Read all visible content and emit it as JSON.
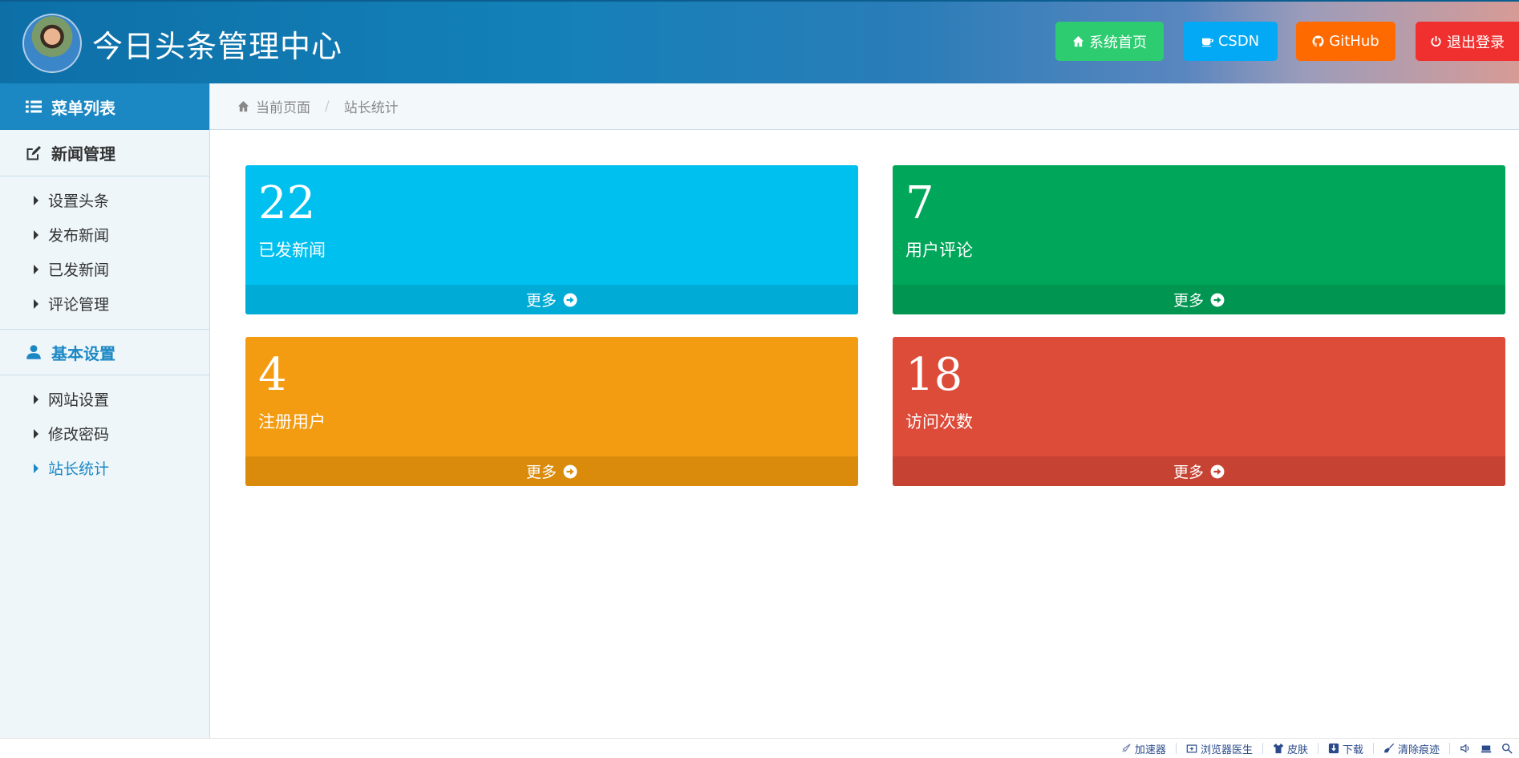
{
  "header": {
    "title": "今日头条管理中心",
    "buttons": [
      {
        "label": "系统首页",
        "icon": "home-icon",
        "color": "#2ecc71"
      },
      {
        "label": "CSDN",
        "icon": "coffee-icon",
        "color": "#03a9f4"
      },
      {
        "label": "GitHub",
        "icon": "github-icon",
        "color": "#ff6a00"
      },
      {
        "label": "退出登录",
        "icon": "power-icon",
        "color": "#f0302f"
      }
    ]
  },
  "sidebar": {
    "menu_title": "菜单列表",
    "groups": [
      {
        "title": "新闻管理",
        "icon": "edit-icon",
        "items": [
          "设置头条",
          "发布新闻",
          "已发新闻",
          "评论管理"
        ]
      },
      {
        "title": "基本设置",
        "icon": "user-icon",
        "items": [
          "网站设置",
          "修改密码",
          "站长统计"
        ]
      }
    ],
    "active_item": "站长统计"
  },
  "breadcrumb": {
    "home": "当前页面",
    "current": "站长统计"
  },
  "cards": [
    {
      "value": "22",
      "label": "已发新闻",
      "more": "更多",
      "color": "#00c0ef",
      "footer_color": "#00acd6"
    },
    {
      "value": "7",
      "label": "用户评论",
      "more": "更多",
      "color": "#00a65a",
      "footer_color": "#009551"
    },
    {
      "value": "4",
      "label": "注册用户",
      "more": "更多",
      "color": "#f39c12",
      "footer_color": "#db8b0b"
    },
    {
      "value": "18",
      "label": "访问次数",
      "more": "更多",
      "color": "#dd4b39",
      "footer_color": "#c64333"
    }
  ],
  "statusbar": {
    "items": [
      "加速器",
      "浏览器医生",
      "皮肤",
      "下载",
      "清除痕迹"
    ]
  }
}
